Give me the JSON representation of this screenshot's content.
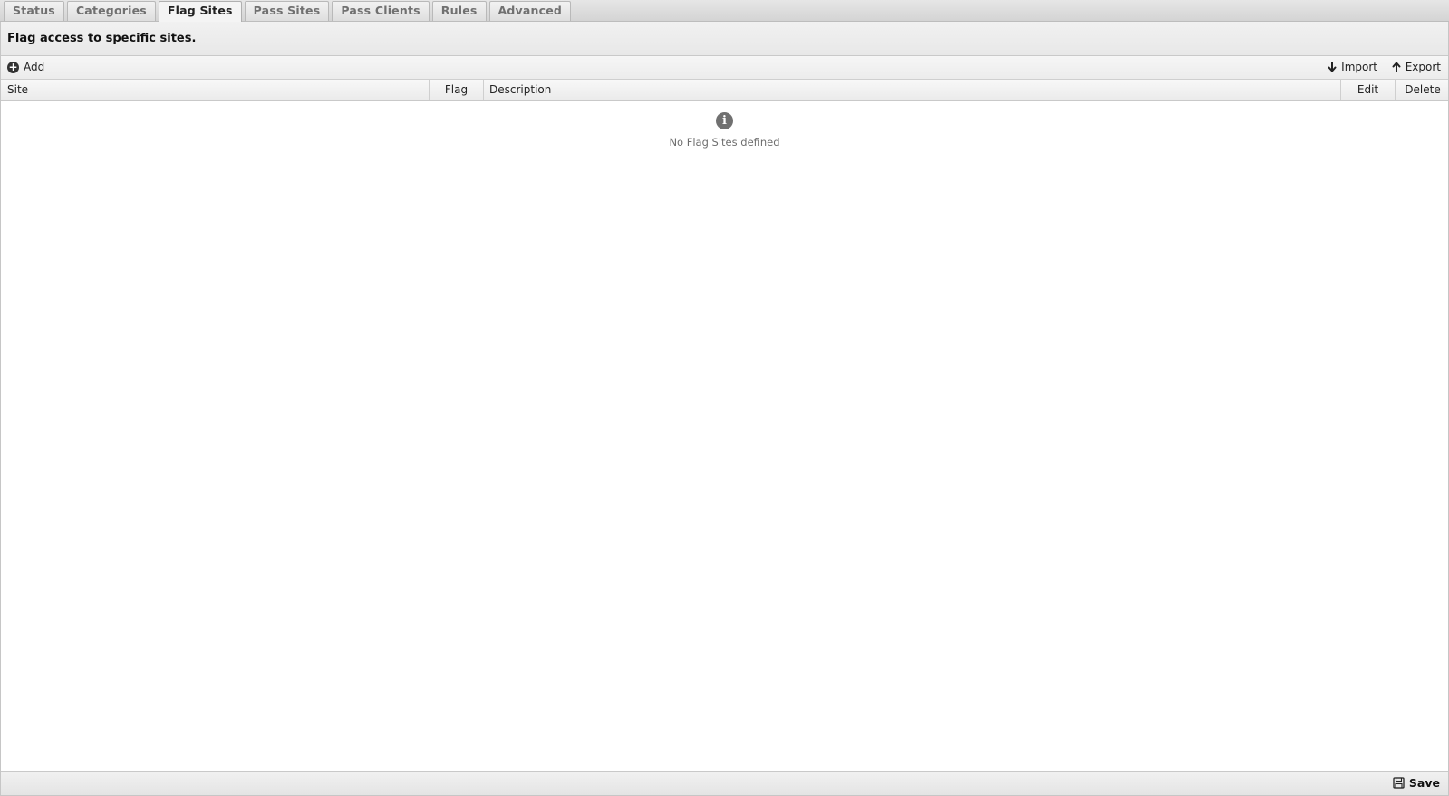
{
  "tabs": [
    {
      "label": "Status",
      "active": false
    },
    {
      "label": "Categories",
      "active": false
    },
    {
      "label": "Flag Sites",
      "active": true
    },
    {
      "label": "Pass Sites",
      "active": false
    },
    {
      "label": "Pass Clients",
      "active": false
    },
    {
      "label": "Rules",
      "active": false
    },
    {
      "label": "Advanced",
      "active": false
    }
  ],
  "panel": {
    "title": "Flag access to specific sites."
  },
  "toolbar": {
    "add_label": "Add",
    "import_label": "Import",
    "export_label": "Export"
  },
  "grid": {
    "columns": {
      "site": "Site",
      "flag": "Flag",
      "description": "Description",
      "edit": "Edit",
      "delete": "Delete"
    },
    "rows": [],
    "empty_text": "No Flag Sites defined",
    "empty_icon": "info-icon"
  },
  "footer": {
    "save_label": "Save"
  },
  "colors": {
    "tab_inactive_text": "#707070",
    "empty_text": "#6e6e6e",
    "info_icon": "#707070"
  }
}
